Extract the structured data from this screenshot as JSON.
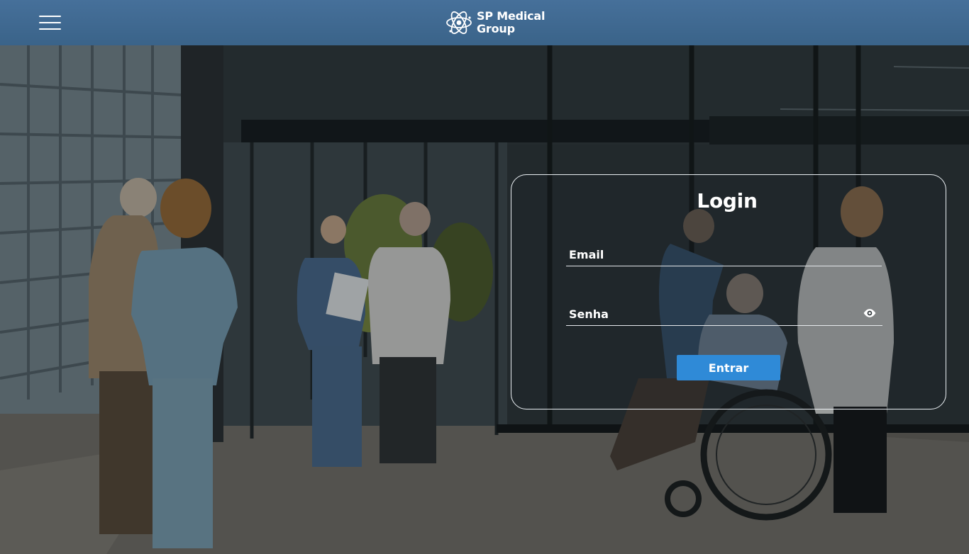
{
  "header": {
    "menu_icon": "hamburger-menu-icon",
    "brand": {
      "logo_icon": "atom-icon",
      "line1": "SP Medical",
      "line2": "Group"
    },
    "background_color": "#3f6890"
  },
  "login": {
    "title": "Login",
    "email": {
      "label": "Email",
      "value": ""
    },
    "password": {
      "label": "Senha",
      "value": "",
      "toggle_icon": "eye-icon"
    },
    "submit_label": "Entrar",
    "submit_color": "#2f8ad7"
  }
}
